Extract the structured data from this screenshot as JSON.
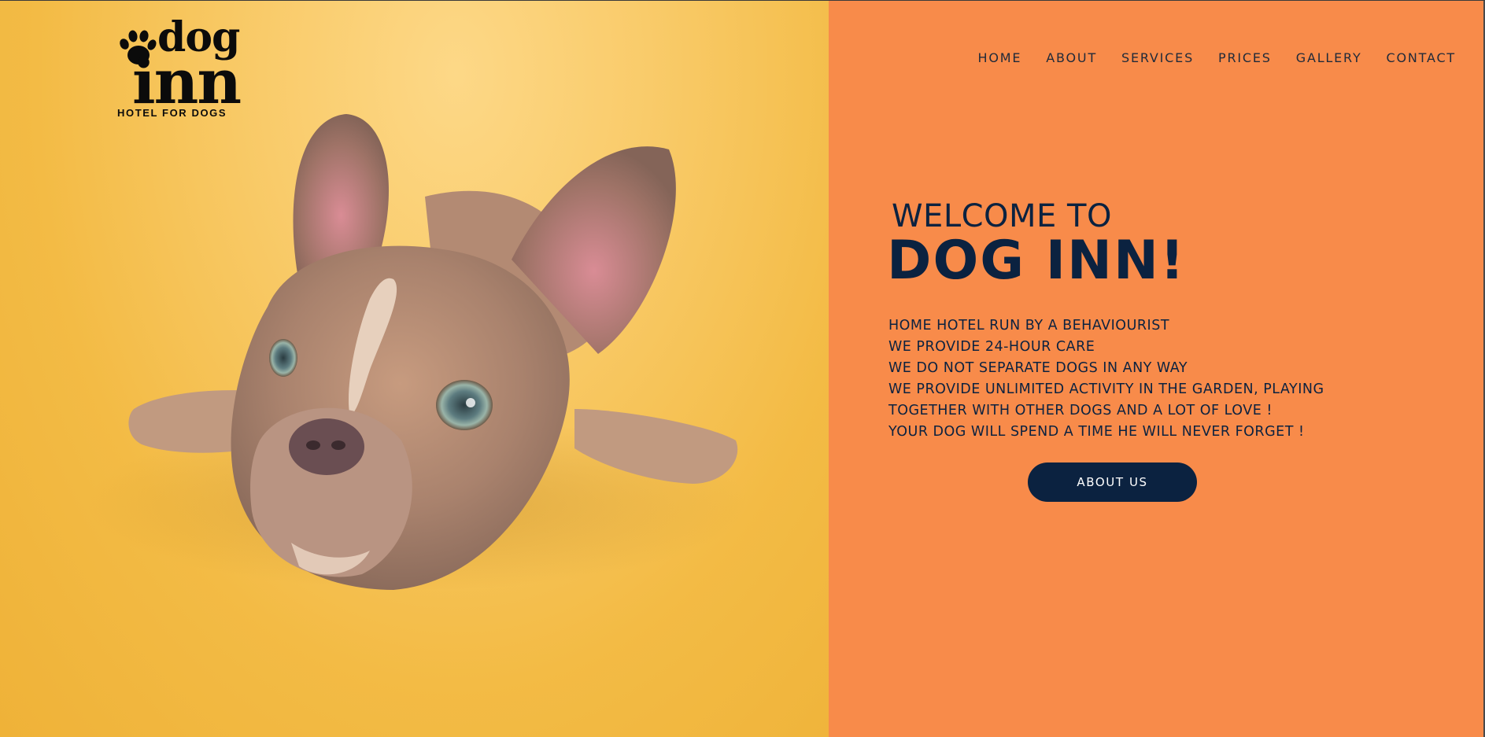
{
  "logo": {
    "word_top": "dog",
    "word_bottom": "inn",
    "tagline": "HOTEL FOR DOGS",
    "icon": "paw-icon"
  },
  "hero_image": {
    "subject": "dog-photo"
  },
  "nav": {
    "items": [
      {
        "label": "HOME"
      },
      {
        "label": "ABOUT"
      },
      {
        "label": "SERVICES"
      },
      {
        "label": "PRICES"
      },
      {
        "label": "GALLERY"
      },
      {
        "label": "CONTACT"
      }
    ]
  },
  "hero": {
    "welcome": "WELCOME TO",
    "title": "DOG INN!",
    "features": [
      "HOME HOTEL RUN BY A BEHAVIOURIST",
      "WE PROVIDE 24-HOUR CARE",
      "WE DO NOT SEPARATE DOGS IN ANY WAY",
      "WE PROVIDE UNLIMITED ACTIVITY IN THE GARDEN, PLAYING",
      "TOGETHER WITH OTHER DOGS AND A LOT OF LOVE !",
      "YOUR DOG WILL SPEND A TIME HE WILL NEVER FORGET !"
    ],
    "cta_label": "ABOUT US"
  },
  "colors": {
    "panel_background": "#f88b4a",
    "photo_background": "#f3bb45",
    "text_navy": "#0b2240",
    "button_background": "#0b2240",
    "button_text": "#ffffff"
  }
}
